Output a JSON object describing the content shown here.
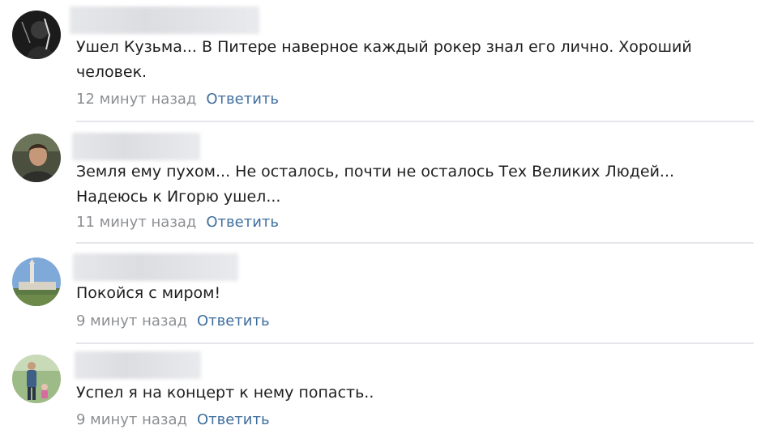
{
  "comments": [
    {
      "text_lines": [
        "Ушел Кузьма... В Питере наверное каждый рокер знал его лично. Хороший",
        "человек."
      ],
      "time": "12 минут назад",
      "reply_label": "Ответить",
      "avatar_icon": "dark-silhouette-avatar"
    },
    {
      "text_lines": [
        "Земля ему пухом... Не осталось, почти не осталось Тех Великих Людей...",
        "Надеюсь к Игорю ушел..."
      ],
      "time": "11 минут назад",
      "reply_label": "Ответить",
      "avatar_icon": "man-portrait-avatar"
    },
    {
      "text_lines": [
        "Покойся с миром!"
      ],
      "time": "9 минут назад",
      "reply_label": "Ответить",
      "avatar_icon": "landscape-tower-avatar"
    },
    {
      "text_lines": [
        "Успел я на концерт к нему попасть.."
      ],
      "time": "9 минут назад",
      "reply_label": "Ответить",
      "avatar_icon": "person-outdoors-avatar"
    }
  ],
  "colors": {
    "reply_link": "#3f6e9e",
    "timestamp": "#8d8f93",
    "divider": "#e4e6ea"
  }
}
